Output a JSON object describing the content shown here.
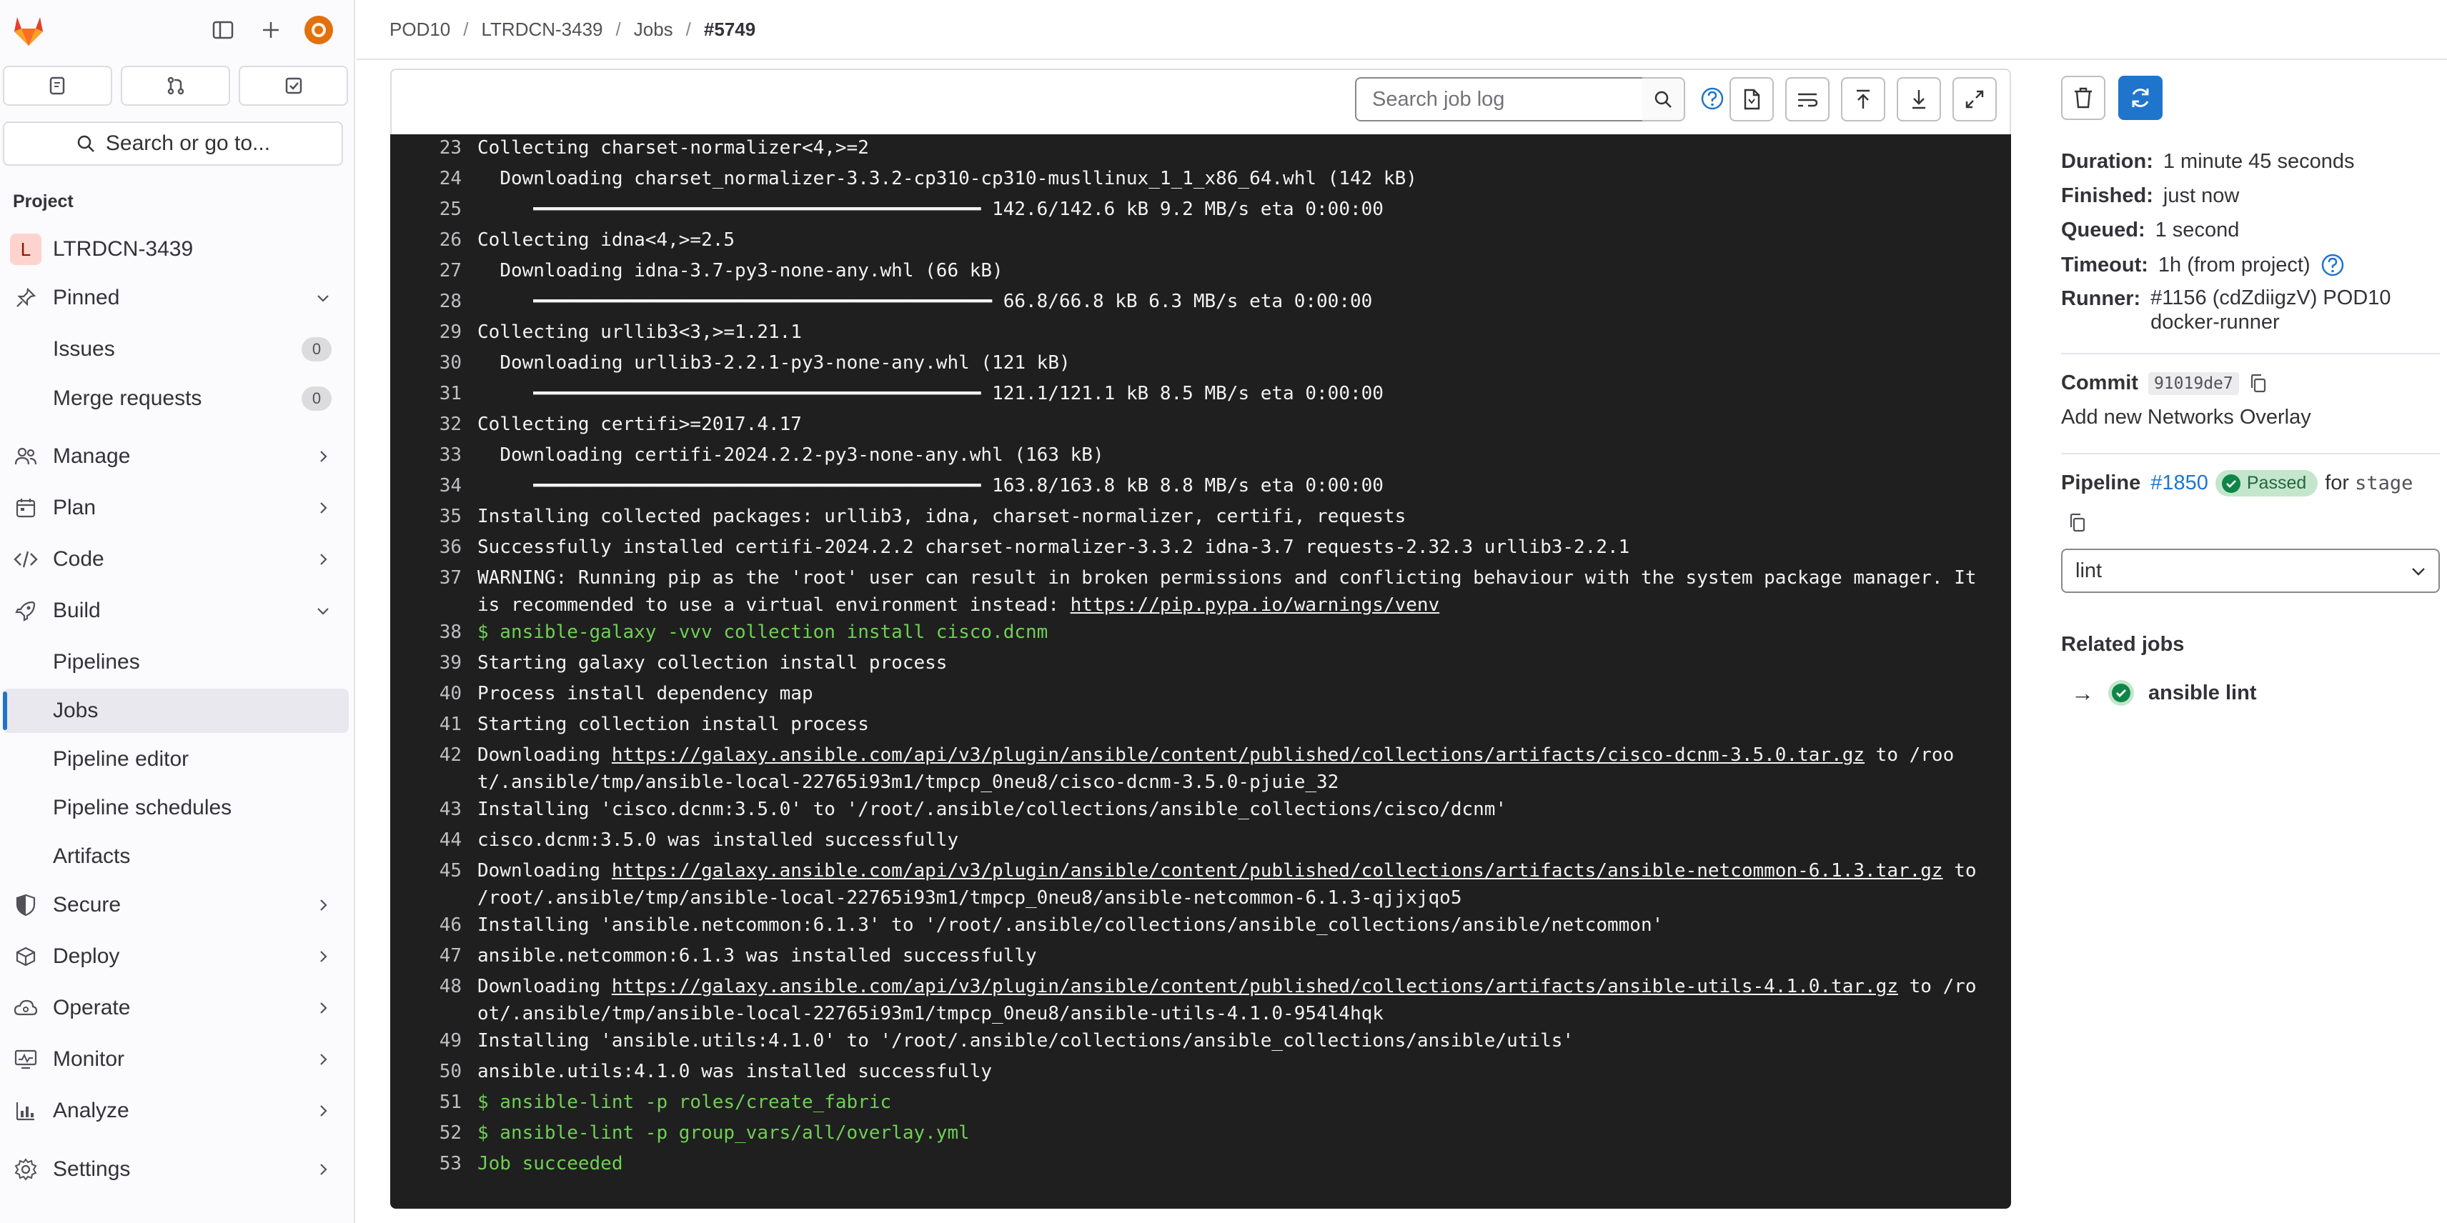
{
  "breadcrumb": [
    "POD10",
    "LTRDCN-3439",
    "Jobs",
    "#5749"
  ],
  "sidebar": {
    "search_label": "Search or go to...",
    "section_label": "Project",
    "project_name": "LTRDCN-3439",
    "project_initial": "L",
    "items": {
      "pinned": "Pinned",
      "issues": "Issues",
      "issues_count": "0",
      "merge_requests": "Merge requests",
      "merge_requests_count": "0",
      "manage": "Manage",
      "plan": "Plan",
      "code": "Code",
      "build": "Build",
      "pipelines": "Pipelines",
      "jobs": "Jobs",
      "pipeline_editor": "Pipeline editor",
      "pipeline_schedules": "Pipeline schedules",
      "artifacts": "Artifacts",
      "secure": "Secure",
      "deploy": "Deploy",
      "operate": "Operate",
      "monitor": "Monitor",
      "analyze": "Analyze",
      "settings": "Settings"
    }
  },
  "log_toolbar": {
    "search_placeholder": "Search job log"
  },
  "log": [
    {
      "n": "23",
      "t": "Collecting charset-normalizer<4,>=2"
    },
    {
      "n": "24",
      "t": "  Downloading charset_normalizer-3.3.2-cp310-cp310-musllinux_1_1_x86_64.whl (142 kB)"
    },
    {
      "n": "25",
      "t": "     ━━━━━━━━━━━━━━━━━━━━━━━━━━━━━━━━━━━━━━━━ 142.6/142.6 kB 9.2 MB/s eta 0:00:00"
    },
    {
      "n": "26",
      "t": "Collecting idna<4,>=2.5"
    },
    {
      "n": "27",
      "t": "  Downloading idna-3.7-py3-none-any.whl (66 kB)"
    },
    {
      "n": "28",
      "t": "     ━━━━━━━━━━━━━━━━━━━━━━━━━━━━━━━━━━━━━━━━━ 66.8/66.8 kB 6.3 MB/s eta 0:00:00"
    },
    {
      "n": "29",
      "t": "Collecting urllib3<3,>=1.21.1"
    },
    {
      "n": "30",
      "t": "  Downloading urllib3-2.2.1-py3-none-any.whl (121 kB)"
    },
    {
      "n": "31",
      "t": "     ━━━━━━━━━━━━━━━━━━━━━━━━━━━━━━━━━━━━━━━━ 121.1/121.1 kB 8.5 MB/s eta 0:00:00"
    },
    {
      "n": "32",
      "t": "Collecting certifi>=2017.4.17"
    },
    {
      "n": "33",
      "t": "  Downloading certifi-2024.2.2-py3-none-any.whl (163 kB)"
    },
    {
      "n": "34",
      "t": "     ━━━━━━━━━━━━━━━━━━━━━━━━━━━━━━━━━━━━━━━━ 163.8/163.8 kB 8.8 MB/s eta 0:00:00"
    },
    {
      "n": "35",
      "t": "Installing collected packages: urllib3, idna, charset-normalizer, certifi, requests"
    },
    {
      "n": "36",
      "t": "Successfully installed certifi-2024.2.2 charset-normalizer-3.3.2 idna-3.7 requests-2.32.3 urllib3-2.2.1"
    },
    {
      "n": "37",
      "t": "WARNING: Running pip as the 'root' user can result in broken permissions and conflicting behaviour with the system package manager. It is recommended to use a virtual environment instead: ",
      "link": "https://pip.pypa.io/warnings/venv"
    },
    {
      "n": "38",
      "t": "$ ansible-galaxy -vvv collection install cisco.dcnm",
      "green": true
    },
    {
      "n": "39",
      "t": "Starting galaxy collection install process"
    },
    {
      "n": "40",
      "t": "Process install dependency map"
    },
    {
      "n": "41",
      "t": "Starting collection install process"
    },
    {
      "n": "42",
      "t": "Downloading ",
      "link": "https://galaxy.ansible.com/api/v3/plugin/ansible/content/published/collections/artifacts/cisco-dcnm-3.5.0.tar.gz",
      "after": " to /root/.ansible/tmp/ansible-local-22765i93m1/tmpcp_0neu8/cisco-dcnm-3.5.0-pjuie_32"
    },
    {
      "n": "43",
      "t": "Installing 'cisco.dcnm:3.5.0' to '/root/.ansible/collections/ansible_collections/cisco/dcnm'"
    },
    {
      "n": "44",
      "t": "cisco.dcnm:3.5.0 was installed successfully"
    },
    {
      "n": "45",
      "t": "Downloading ",
      "link": "https://galaxy.ansible.com/api/v3/plugin/ansible/content/published/collections/artifacts/ansible-netcommon-6.1.3.tar.gz",
      "after": " to /root/.ansible/tmp/ansible-local-22765i93m1/tmpcp_0neu8/ansible-netcommon-6.1.3-qjjxjqo5"
    },
    {
      "n": "46",
      "t": "Installing 'ansible.netcommon:6.1.3' to '/root/.ansible/collections/ansible_collections/ansible/netcommon'"
    },
    {
      "n": "47",
      "t": "ansible.netcommon:6.1.3 was installed successfully"
    },
    {
      "n": "48",
      "t": "Downloading ",
      "link": "https://galaxy.ansible.com/api/v3/plugin/ansible/content/published/collections/artifacts/ansible-utils-4.1.0.tar.gz",
      "after": " to /root/.ansible/tmp/ansible-local-22765i93m1/tmpcp_0neu8/ansible-utils-4.1.0-954l4hqk"
    },
    {
      "n": "49",
      "t": "Installing 'ansible.utils:4.1.0' to '/root/.ansible/collections/ansible_collections/ansible/utils'"
    },
    {
      "n": "50",
      "t": "ansible.utils:4.1.0 was installed successfully"
    },
    {
      "n": "51",
      "t": "$ ansible-lint -p roles/create_fabric",
      "green": true
    },
    {
      "n": "52",
      "t": "$ ansible-lint -p group_vars/all/overlay.yml",
      "green": true
    },
    {
      "n": "53",
      "t": "Job succeeded",
      "green": true
    }
  ],
  "job": {
    "duration_label": "Duration:",
    "duration": "1 minute 45 seconds",
    "finished_label": "Finished:",
    "finished": "just now",
    "queued_label": "Queued:",
    "queued": "1 second",
    "timeout_label": "Timeout:",
    "timeout": "1h (from project)",
    "runner_label": "Runner:",
    "runner_line1": "#1156 (cdZdiigzV) POD10",
    "runner_line2": "docker-runner",
    "commit_label": "Commit",
    "commit_sha": "91019de7",
    "commit_title": "Add new Networks Overlay",
    "pipeline_label": "Pipeline",
    "pipeline_id": "#1850",
    "pipeline_status": "Passed",
    "pipeline_for": "for",
    "pipeline_ref": "stage",
    "stage_selected": "lint",
    "related_jobs_label": "Related jobs",
    "related_job_arrow": "→",
    "related_job_name": "ansible lint"
  },
  "colors": {
    "accent": "#1f75cb",
    "success": "#108548",
    "log_bg": "#1f1f1f",
    "log_green": "#6fcf54"
  }
}
